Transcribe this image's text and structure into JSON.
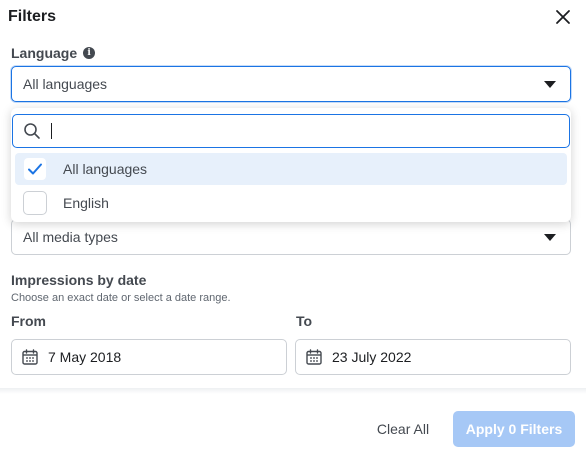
{
  "dialog": {
    "title": "Filters"
  },
  "language": {
    "label": "Language",
    "selected": "All languages",
    "search_value": "",
    "options": [
      {
        "label": "All languages",
        "checked": true
      },
      {
        "label": "English",
        "checked": false
      }
    ]
  },
  "media_type": {
    "selected": "All media types"
  },
  "impressions": {
    "title": "Impressions by date",
    "subtitle": "Choose an exact date or select a date range.",
    "from_label": "From",
    "to_label": "To",
    "from_value": "7 May 2018",
    "to_value": "23 July 2022"
  },
  "footer": {
    "clear_label": "Clear All",
    "apply_label": "Apply 0 Filters"
  },
  "colors": {
    "accent": "#1b74e4",
    "apply_disabled": "#a6c8f6",
    "selected_row": "#e7f0fb"
  },
  "icons": [
    "close-icon",
    "info-icon",
    "chevron-down-icon",
    "search-icon",
    "check-icon",
    "calendar-icon"
  ]
}
